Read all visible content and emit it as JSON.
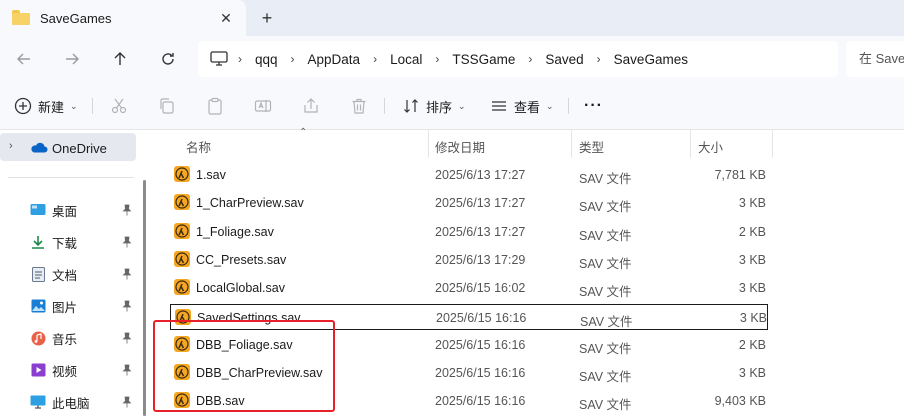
{
  "window": {
    "tab_title": "SaveGames",
    "new_tab": "+",
    "close": "✕"
  },
  "address": {
    "crumbs": [
      "qqq",
      "AppData",
      "Local",
      "TSSGame",
      "Saved",
      "SaveGames"
    ],
    "search_placeholder": "在 SaveGames 中搜索"
  },
  "toolbar": {
    "new_label": "新建",
    "sort_label": "排序",
    "view_label": "查看",
    "more_label": "···"
  },
  "sidebar": {
    "onedrive": "OneDrive",
    "items": [
      {
        "label": "桌面",
        "icon": "desktop-icon"
      },
      {
        "label": "下载",
        "icon": "download-icon"
      },
      {
        "label": "文档",
        "icon": "document-icon"
      },
      {
        "label": "图片",
        "icon": "pictures-icon"
      },
      {
        "label": "音乐",
        "icon": "music-icon"
      },
      {
        "label": "视频",
        "icon": "video-icon"
      },
      {
        "label": "此电脑",
        "icon": "computer-icon"
      }
    ]
  },
  "columns": {
    "name": "名称",
    "date": "修改日期",
    "type": "类型",
    "size": "大小"
  },
  "files": [
    {
      "name": "1.sav",
      "date": "2025/6/13 17:27",
      "type": "SAV 文件",
      "size": "7,781 KB"
    },
    {
      "name": "1_CharPreview.sav",
      "date": "2025/6/13 17:27",
      "type": "SAV 文件",
      "size": "3 KB"
    },
    {
      "name": "1_Foliage.sav",
      "date": "2025/6/13 17:27",
      "type": "SAV 文件",
      "size": "2 KB"
    },
    {
      "name": "CC_Presets.sav",
      "date": "2025/6/13 17:29",
      "type": "SAV 文件",
      "size": "3 KB"
    },
    {
      "name": "LocalGlobal.sav",
      "date": "2025/6/15 16:02",
      "type": "SAV 文件",
      "size": "3 KB"
    },
    {
      "name": "SavedSettings.sav",
      "date": "2025/6/15 16:16",
      "type": "SAV 文件",
      "size": "3 KB"
    },
    {
      "name": "DBB_Foliage.sav",
      "date": "2025/6/15 16:16",
      "type": "SAV 文件",
      "size": "2 KB"
    },
    {
      "name": "DBB_CharPreview.sav",
      "date": "2025/6/15 16:16",
      "type": "SAV 文件",
      "size": "3 KB"
    },
    {
      "name": "DBB.sav",
      "date": "2025/6/15 16:16",
      "type": "SAV 文件",
      "size": "9,403 KB"
    }
  ],
  "selected_index": 5,
  "colors": {
    "highlight_box": "#e8202a",
    "file_icon_bg": "#f5a623",
    "accent": "#0067c0"
  }
}
